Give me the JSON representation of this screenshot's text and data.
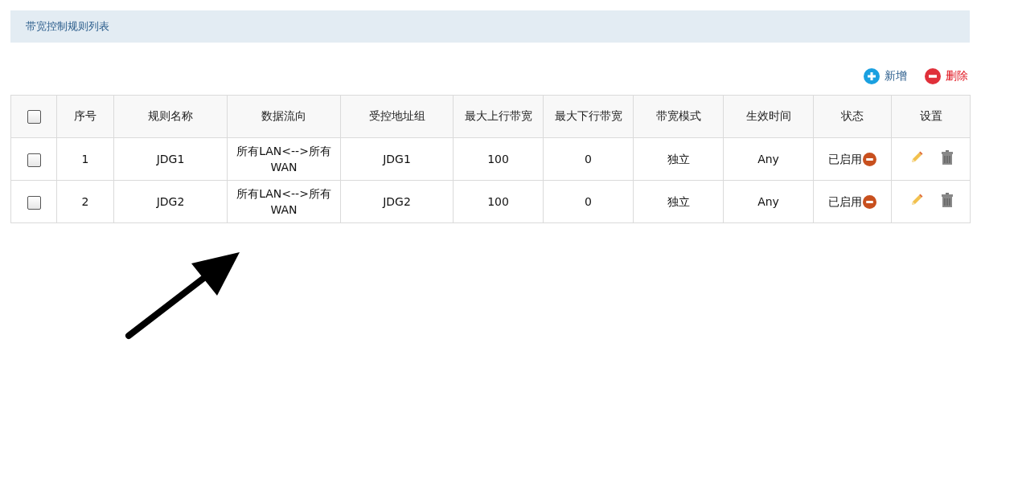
{
  "panel": {
    "title": "带宽控制规则列表"
  },
  "toolbar": [
    {
      "kind": "add",
      "label": "新增"
    },
    {
      "kind": "delete",
      "label": "删除"
    }
  ],
  "table": {
    "select_all": {
      "checked": false
    },
    "columns": [
      "序号",
      "规则名称",
      "数据流向",
      "受控地址组",
      "最大上行带宽",
      "最大下行带宽",
      "带宽模式",
      "生效时间",
      "状态",
      "设置"
    ],
    "rows": [
      {
        "checked": false,
        "cells": [
          "1",
          "JDG1",
          "所有LAN<-->所有WAN",
          "JDG1",
          "100",
          "0",
          "独立",
          "Any"
        ],
        "status": "已启用"
      },
      {
        "checked": false,
        "cells": [
          "2",
          "JDG2",
          "所有LAN<-->所有WAN",
          "JDG2",
          "100",
          "0",
          "独立",
          "Any"
        ],
        "status": "已启用"
      }
    ]
  }
}
